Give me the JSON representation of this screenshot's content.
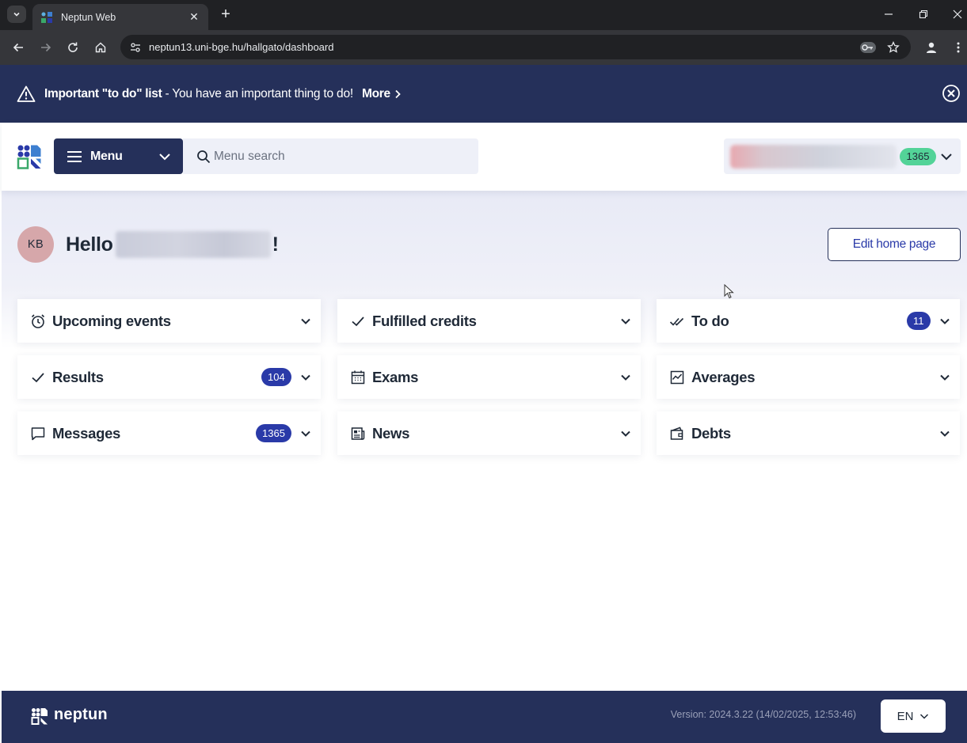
{
  "browser": {
    "tab_title": "Neptun Web",
    "tab_close": "✕",
    "new_tab": "+",
    "url": "neptun13.uni-bge.hu/hallgato/dashboard"
  },
  "banner": {
    "strong": "Important \"to do\" list",
    "text": "- You have an important thing to do!",
    "more": "More"
  },
  "header": {
    "menu_label": "Menu",
    "search_placeholder": "Menu search",
    "user_badge": "1365"
  },
  "hero": {
    "avatar_initials": "KB",
    "greeting": "Hello",
    "greeting_end": "!",
    "edit_button": "Edit home page"
  },
  "cards": [
    {
      "title": "Upcoming events",
      "icon": "alarm-clock-icon",
      "badge": ""
    },
    {
      "title": "Fulfilled credits",
      "icon": "check-icon",
      "badge": ""
    },
    {
      "title": "To do",
      "icon": "double-check-icon",
      "badge": "11"
    },
    {
      "title": "Results",
      "icon": "check-icon",
      "badge": "104"
    },
    {
      "title": "Exams",
      "icon": "calendar-icon",
      "badge": ""
    },
    {
      "title": "Averages",
      "icon": "line-chart-icon",
      "badge": ""
    },
    {
      "title": "Messages",
      "icon": "message-icon",
      "badge": "1365"
    },
    {
      "title": "News",
      "icon": "newspaper-icon",
      "badge": ""
    },
    {
      "title": "Debts",
      "icon": "wallet-icon",
      "badge": ""
    }
  ],
  "footer": {
    "brand": "neptun",
    "version": "Version: 2024.3.22 (14/02/2025, 12:53:46)",
    "language": "EN"
  },
  "colors": {
    "navy": "#25305a",
    "badge_blue": "#2a3aa8",
    "badge_green": "#53d398",
    "hero_bg": "#e8eaf6"
  }
}
